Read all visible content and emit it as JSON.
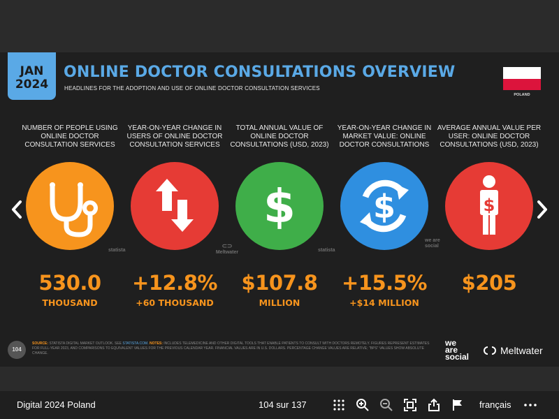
{
  "slide": {
    "badge_month": "JAN",
    "badge_year": "2024",
    "title": "ONLINE DOCTOR CONSULTATIONS OVERVIEW",
    "subtitle": "HEADLINES FOR THE ADOPTION AND USE OF ONLINE DOCTOR CONSULTATION SERVICES",
    "country_label": "POLAND",
    "flag_colors": [
      "#ffffff",
      "#dc143c"
    ],
    "accent_color": "#5aa9e6",
    "value_color": "#f7941d",
    "metrics": [
      {
        "label": "NUMBER OF PEOPLE USING ONLINE DOCTOR CONSULTATION SERVICES",
        "icon": "stethoscope-icon",
        "circle_color": "#f7941d",
        "value": "530.0",
        "sub": "THOUSAND"
      },
      {
        "label": "YEAR-ON-YEAR CHANGE IN USERS OF ONLINE DOCTOR CONSULTATION SERVICES",
        "icon": "up-down-arrows-icon",
        "circle_color": "#e63b35",
        "value": "+12.8%",
        "sub": "+60 THOUSAND"
      },
      {
        "label": "TOTAL ANNUAL VALUE OF ONLINE DOCTOR CONSULTATIONS (USD, 2023)",
        "icon": "dollar-icon",
        "circle_color": "#3fae49",
        "value": "$107.8",
        "sub": "MILLION"
      },
      {
        "label": "YEAR-ON-YEAR CHANGE IN MARKET VALUE: ONLINE DOCTOR CONSULTATIONS",
        "icon": "dollar-cycle-icon",
        "circle_color": "#2f8fe0",
        "value": "+15.5%",
        "sub": "+$14 MILLION"
      },
      {
        "label": "AVERAGE ANNUAL VALUE PER USER: ONLINE DOCTOR CONSULTATIONS (USD, 2023)",
        "icon": "person-dollar-icon",
        "circle_color": "#e63b35",
        "value": "$205",
        "sub": ""
      }
    ],
    "watermarks": {
      "statista_1": "statista",
      "meltwater_small": "Meltwater",
      "statista_2": "statista",
      "was_small": "we are social"
    },
    "page_number": "104",
    "notes_source_label": "SOURCE:",
    "notes_source": "STATISTA DIGITAL MARKET OUTLOOK. SEE",
    "notes_link": "STATISTA.COM.",
    "notes_label": "NOTES:",
    "notes_text": "INCLUDES TELEMEDICINE AND OTHER DIGITAL TOOLS THAT ENABLE PATIENTS TO CONSULT WITH DOCTORS REMOTELY. FIGURES REPRESENT ESTIMATES FOR FULL-YEAR 2023, AND COMPARISONS TO EQUIVALENT VALUES FOR THE PREVIOUS CALENDAR YEAR. FINANCIAL VALUES ARE IN U.S. DOLLARS. PERCENTAGE CHANGE VALUES ARE RELATIVE; \"BPS\" VALUES SHOW ABSOLUTE CHANGE.",
    "brand_was_1": "we",
    "brand_was_2": "are",
    "brand_was_3": "social",
    "brand_meltwater": "Meltwater"
  },
  "bottombar": {
    "doc_title": "Digital 2024 Poland",
    "page_indicator": "104 sur 137",
    "language": "français",
    "icons": [
      "grid-icon",
      "zoom-in-icon",
      "zoom-out-icon",
      "fullscreen-icon",
      "share-icon",
      "flag-icon",
      "more-icon"
    ]
  }
}
